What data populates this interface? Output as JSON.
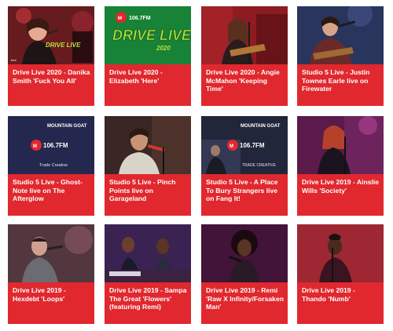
{
  "cards": [
    {
      "title": "Drive Live 2020 - Danika Smith 'Fuck You All'",
      "thumb_text": "DRIVE LIVE",
      "icon": "video-thumbnail"
    },
    {
      "title": "Drive Live 2020 - Elizabeth 'Here'",
      "thumb_text": "DRIVE LIVE",
      "thumb_sub": "2020",
      "thumb_freq": "106.7FM",
      "icon": "video-thumbnail"
    },
    {
      "title": "Drive Live 2020 - Angie McMahon 'Keeping Time'",
      "icon": "video-thumbnail"
    },
    {
      "title": "Studio 5 Live - Justin Townes Earle live on Firewater",
      "icon": "video-thumbnail"
    },
    {
      "title": "Studio 5 Live - Ghost-Note live on The Afterglow",
      "thumb_text": "MOUNTAIN GOAT",
      "thumb_freq": "106.7FM",
      "thumb_sub": "Trade Creative",
      "icon": "video-thumbnail"
    },
    {
      "title": "Studio 5 Live - Pinch Points live on Garageland",
      "icon": "video-thumbnail"
    },
    {
      "title": "Studio 5 Live - A Place To Bury Strangers live on Fang It!",
      "thumb_text": "MOUNTAIN GOAT",
      "thumb_freq": "106.7FM",
      "thumb_sub": "TRADE CREATIVE",
      "icon": "video-thumbnail"
    },
    {
      "title": "Drive Live 2019 - Ainslie Wills 'Society'",
      "icon": "video-thumbnail"
    },
    {
      "title": "Drive Live 2019 - Hexdebt 'Loops'",
      "icon": "video-thumbnail"
    },
    {
      "title": "Drive Live 2019 - Sampa The Great 'Flowers' (featuring Remi)",
      "icon": "video-thumbnail"
    },
    {
      "title": "Drive Live 2019 - Remi 'Raw X Infinity/Forsaken Man'",
      "icon": "video-thumbnail"
    },
    {
      "title": "Drive Live 2019 - Thando 'Numb'",
      "icon": "video-thumbnail"
    }
  ],
  "colors": {
    "card_bg": "#e0282e",
    "caption_text": "#ffffff",
    "drive_green": "#b6e33a"
  }
}
